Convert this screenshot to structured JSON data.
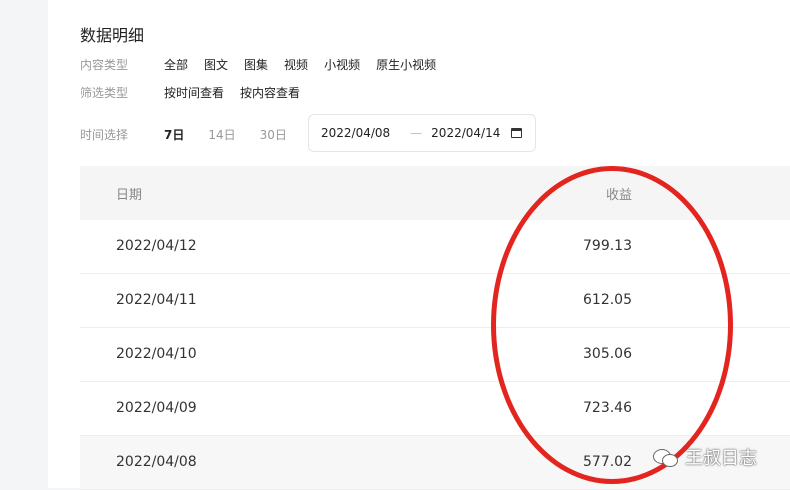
{
  "title": "数据明细",
  "content_type": {
    "label": "内容类型",
    "options": [
      "全部",
      "图文",
      "图集",
      "视频",
      "小视频",
      "原生小视频"
    ]
  },
  "filter_type": {
    "label": "筛选类型",
    "options": [
      "按时间查看",
      "按内容查看"
    ]
  },
  "time_select": {
    "label": "时间选择",
    "options": [
      "7日",
      "14日",
      "30日"
    ],
    "active": "7日",
    "date_start": "2022/04/08",
    "date_sep": "—",
    "date_end": "2022/04/14"
  },
  "table": {
    "headers": [
      "日期",
      "收益"
    ],
    "rows": [
      {
        "date": "2022/04/12",
        "income": "799.13"
      },
      {
        "date": "2022/04/11",
        "income": "612.05"
      },
      {
        "date": "2022/04/10",
        "income": "305.06"
      },
      {
        "date": "2022/04/09",
        "income": "723.46"
      },
      {
        "date": "2022/04/08",
        "income": "577.02"
      }
    ]
  },
  "annotation_color": "#e3251f",
  "watermark": {
    "icon": "wechat-icon",
    "text": "王叔日志"
  }
}
